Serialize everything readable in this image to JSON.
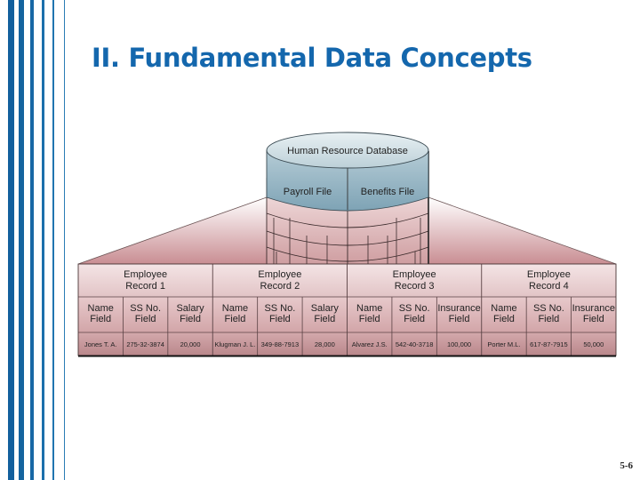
{
  "slide": {
    "title": "II. Fundamental Data Concepts",
    "page_number": "5-6",
    "accent_color": "#1467ad"
  },
  "database": {
    "name": "Human Resource Database",
    "files": [
      "Payroll File",
      "Benefits File"
    ]
  },
  "records": [
    {
      "label_line1": "Employee",
      "label_line2": "Record 1",
      "fields": [
        {
          "line1": "Name",
          "line2": "Field",
          "value": "Jones T. A."
        },
        {
          "line1": "SS No.",
          "line2": "Field",
          "value": "275-32-3874"
        },
        {
          "line1": "Salary",
          "line2": "Field",
          "value": "20,000"
        }
      ]
    },
    {
      "label_line1": "Employee",
      "label_line2": "Record 2",
      "fields": [
        {
          "line1": "Name",
          "line2": "Field",
          "value": "Klugman J. L."
        },
        {
          "line1": "SS No.",
          "line2": "Field",
          "value": "349-88-7913"
        },
        {
          "line1": "Salary",
          "line2": "Field",
          "value": "28,000"
        }
      ]
    },
    {
      "label_line1": "Employee",
      "label_line2": "Record 3",
      "fields": [
        {
          "line1": "Name",
          "line2": "Field",
          "value": "Alvarez J.S."
        },
        {
          "line1": "SS No.",
          "line2": "Field",
          "value": "542-40-3718"
        },
        {
          "line1": "Insurance",
          "line2": "Field",
          "value": "100,000"
        }
      ]
    },
    {
      "label_line1": "Employee",
      "label_line2": "Record 4",
      "fields": [
        {
          "line1": "Name",
          "line2": "Field",
          "value": "Porter M.L."
        },
        {
          "line1": "SS No.",
          "line2": "Field",
          "value": "617-87-7915"
        },
        {
          "line1": "Insurance",
          "line2": "Field",
          "value": "50,000"
        }
      ]
    }
  ]
}
